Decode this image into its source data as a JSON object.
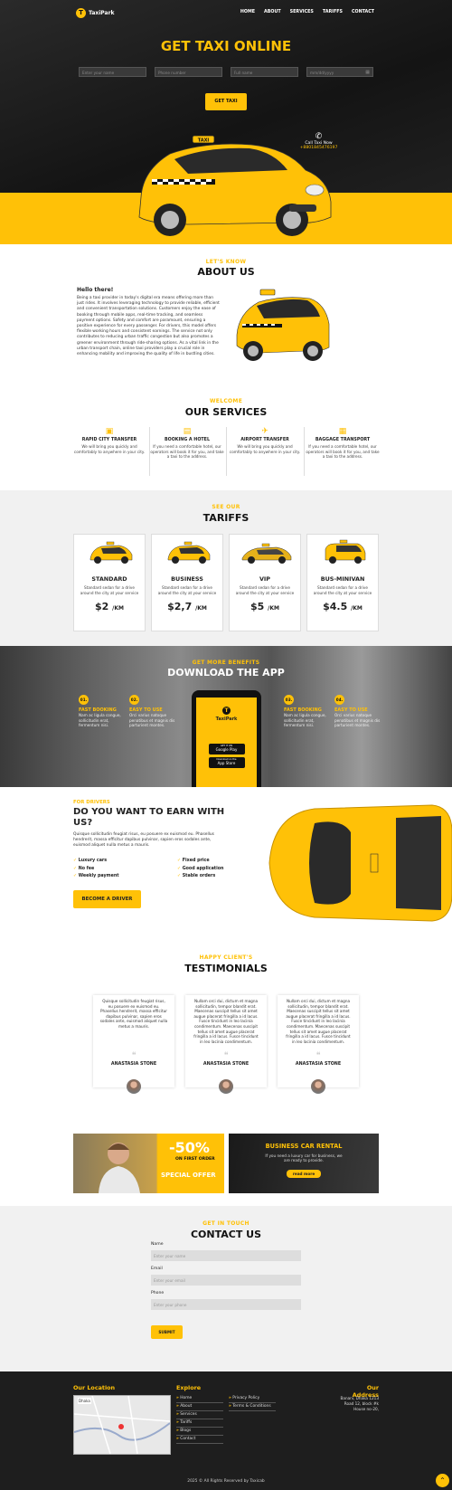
{
  "brand": {
    "name": "TaxiPark",
    "logo_letter": "T"
  },
  "nav": [
    "HOME",
    "ABOUT",
    "SERVICES",
    "TARIFFS",
    "CONTACT"
  ],
  "hero": {
    "title": "GET TAXI ONLINE",
    "placeholders": [
      "Enter your name",
      "Phone number",
      "Full name",
      "mm/dd/yyyy"
    ],
    "button": "GET TAXI",
    "call_label": "Call Taxi Now",
    "call_number": "+8801845476197",
    "taxi_sign": "TAXI"
  },
  "about": {
    "kicker": "LET'S KNOW",
    "title": "ABOUT US",
    "hello": "Hello there!",
    "text": "Being a taxi provider in today's digital era means offering more than just rides. It involves leveraging technology to provide reliable, efficient and convenient transportation solutions. Customers enjoy the ease of booking through mobile apps, real-time tracking, and seamless payment options. Safety and comfort are paramount, ensuring a positive experience for every passenger. For drivers, this model offers flexible working hours and consistent earnings. The service not only contributes to reducing urban traffic congestion but also promotes a greener environment through ride-sharing options. As a vital link in the urban transport chain, online taxi providers play a crucial role in enhancing mobility and improving the quality of life in bustling cities."
  },
  "services": {
    "kicker": "WELCOME",
    "title": "OUR SERVICES",
    "items": [
      {
        "icon": "taxi-icon",
        "title": "RAPID CITY TRANSFER",
        "text": "We will bring you quickly and comfortably to anywhere in your city."
      },
      {
        "icon": "hotel-icon",
        "title": "BOOKING A HOTEL",
        "text": "If you need a comfortable hotel, our operators will book it for you, and take a taxi to the address."
      },
      {
        "icon": "plane-icon",
        "title": "AIRPORT TRANSFER",
        "text": "We will bring you quickly and comfortably to anywhere in your city."
      },
      {
        "icon": "suitcase-icon",
        "title": "BAGGAGE TRANSPORT",
        "text": "If you need a comfortable hotel, our operators will book it for you, and take a taxi to the address."
      }
    ]
  },
  "tariffs": {
    "kicker": "SEE OUR",
    "title": "TARIFFS",
    "items": [
      {
        "name": "STANDARD",
        "text": "Standard sedan for a drive around the city at your service",
        "price": "$2",
        "unit": "/KM"
      },
      {
        "name": "BUSINESS",
        "text": "Standard sedan for a drive around the city at your service",
        "price": "$2,7",
        "unit": "/KM"
      },
      {
        "name": "VIP",
        "text": "Standard sedan for a drive around the city at your service",
        "price": "$5",
        "unit": "/KM"
      },
      {
        "name": "BUS-MINIVAN",
        "text": "Standard sedan for a drive around the city at your service",
        "price": "$4.5",
        "unit": "/KM"
      }
    ]
  },
  "app": {
    "kicker": "GET MORE BENEFITS",
    "title": "DOWNLOAD THE APP",
    "features": [
      {
        "num": "01.",
        "title": "FAST BOOKING",
        "text": "Nam ac ligula congue, sollicitudin erat, fermentum nisi."
      },
      {
        "num": "02.",
        "title": "EASY TO USE",
        "text": "Orci varius natoque penatibus et magnis dis parturient montes."
      },
      {
        "num": "03.",
        "title": "FAST BOOKING",
        "text": "Nam ac ligula congue, sollicitudin erat, fermentum nisi."
      },
      {
        "num": "04.",
        "title": "EASY TO USE",
        "text": "Orci varius natoque penatibus et magnis dis parturient montes."
      }
    ],
    "phone_brand": "TaxiPark",
    "google_small": "GET IT ON",
    "google": "Google Play",
    "apple_small": "Download on the",
    "apple": "App Store"
  },
  "drivers": {
    "kicker": "FOR DRIVERS",
    "title": "DO YOU WANT TO EARN WITH US?",
    "text": "Quisque sollicitudin feugiat risus, eu posuere ex euismod eu. Phasellus hendrerit, massa efficitur dapibus pulvinar, sapien eros sodales ante, euismod aliquet nulla metus a mauris.",
    "checks": [
      "Luxury cars",
      "No fee",
      "Weekly payment",
      "Fixed price",
      "Good application",
      "Stable orders"
    ],
    "button": "BECOME A DRIVER"
  },
  "testimonials": {
    "kicker": "HAPPY CLIENT'S",
    "title": "TESTIMONIALS",
    "items": [
      {
        "text": "Quisque sollicitudin feugiat risus, eu posuere ex euismod eu. Phasellus hendrerit, massa efficitur dapibus pulvinar, sapien eros sodales ante, euismod aliquet nulla metus a mauris.",
        "name": "ANASTASIA STONE"
      },
      {
        "text": "Nullam orci dui, dictum et magna sollicitudin, tempor blandit erat. Maecenas suscipit tellus sit amet augue placerat fringilla a id lacus. Fusce tincidunt in leo lacinia condimentum. Maecenas suscipit tellus sit amet augue placerat fringilla a id lacus. Fusce tincidunt in leo lacinia condimentum.",
        "name": "ANASTASIA STONE"
      },
      {
        "text": "Nullam orci dui, dictum et magna sollicitudin, tempor blandit erat. Maecenas suscipit tellus sit amet augue placerat fringilla a id lacus. Fusce tincidunt in leo lacinia condimentum. Maecenas suscipit tellus sit amet augue placerat fringilla a id lacus. Fusce tincidunt in leo lacinia condimentum.",
        "name": "ANASTASIA STONE"
      }
    ]
  },
  "promo": {
    "discount": "-50%",
    "first_order": "ON FIRST ORDER",
    "special": "SPECIAL OFFER",
    "rental_title": "BUSINESS CAR RENTAL",
    "rental_text": "If you need a luxury car for business, we are ready to provide.",
    "rental_button": "read more"
  },
  "contact": {
    "kicker": "GET IN TOUCH",
    "title": "CONTACT US",
    "fields": [
      {
        "label": "Name",
        "placeholder": "Enter your name"
      },
      {
        "label": "Email",
        "placeholder": "Enter your email"
      },
      {
        "label": "Phone",
        "placeholder": "Enter your phone"
      }
    ],
    "button": "SUBMIT"
  },
  "footer": {
    "location_title": "Our Location",
    "map_label": "Dhaka",
    "explore_title": "Explore",
    "links_col1": [
      "Home",
      "About",
      "Services",
      "Tariffs",
      "Blogs",
      "Contact"
    ],
    "links_col2": [
      "Privacy Policy",
      "Terms & Conditions"
    ],
    "address_title": "Our Address",
    "address_lines": [
      "Banani, Dhaka 1213",
      "Road 12, block #k",
      "House no-20,"
    ],
    "copyright": "2025 © All Rights Reserved by Taxicab"
  },
  "colors": {
    "accent": "#ffc107",
    "dark": "#1e1e1e"
  }
}
